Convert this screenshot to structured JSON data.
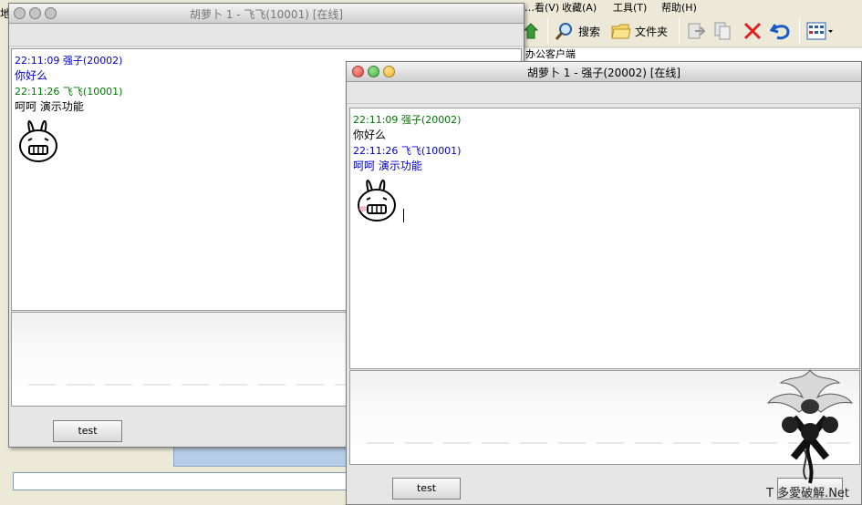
{
  "background_app": {
    "left_edge_text": "地",
    "menu": [
      {
        "label": "…看(V)"
      },
      {
        "label": "收藏(A)"
      },
      {
        "label": "工具(T)"
      },
      {
        "label": "帮助(H)"
      }
    ],
    "toolbar": {
      "search_label": "搜索",
      "folders_label": "文件夹"
    },
    "address_text": "办公客户端"
  },
  "window_left": {
    "title": "胡萝卜 1 - 飞飞(10001)  [在线]",
    "messages": [
      {
        "header": "22:11:09 强子(20002)",
        "header_color": "#0000cc",
        "body": "你好么",
        "body_color": "#0000cc"
      },
      {
        "header": "22:11:26 飞飞(10001)",
        "header_color": "#007700",
        "body": "呵呵 演示功能",
        "body_color": "#000000"
      }
    ],
    "send_button": "test"
  },
  "window_right": {
    "title": "胡萝卜 1 - 强子(20002)  [在线]",
    "messages": [
      {
        "header": "22:11:09 强子(20002)",
        "header_color": "#007700",
        "body": "你好么",
        "body_color": "#000000"
      },
      {
        "header": "22:11:26 飞飞(10001)",
        "header_color": "#0000cc",
        "body": "呵呵 演示功能",
        "body_color": "#0000cc"
      }
    ],
    "send_button": "test"
  },
  "watermark": {
    "text": "T 多愛破解.Net"
  },
  "colors": {
    "close": "#e0443a",
    "minimize": "#f5b427",
    "zoom": "#38b540",
    "inactive_light": "#b8b8b8"
  }
}
